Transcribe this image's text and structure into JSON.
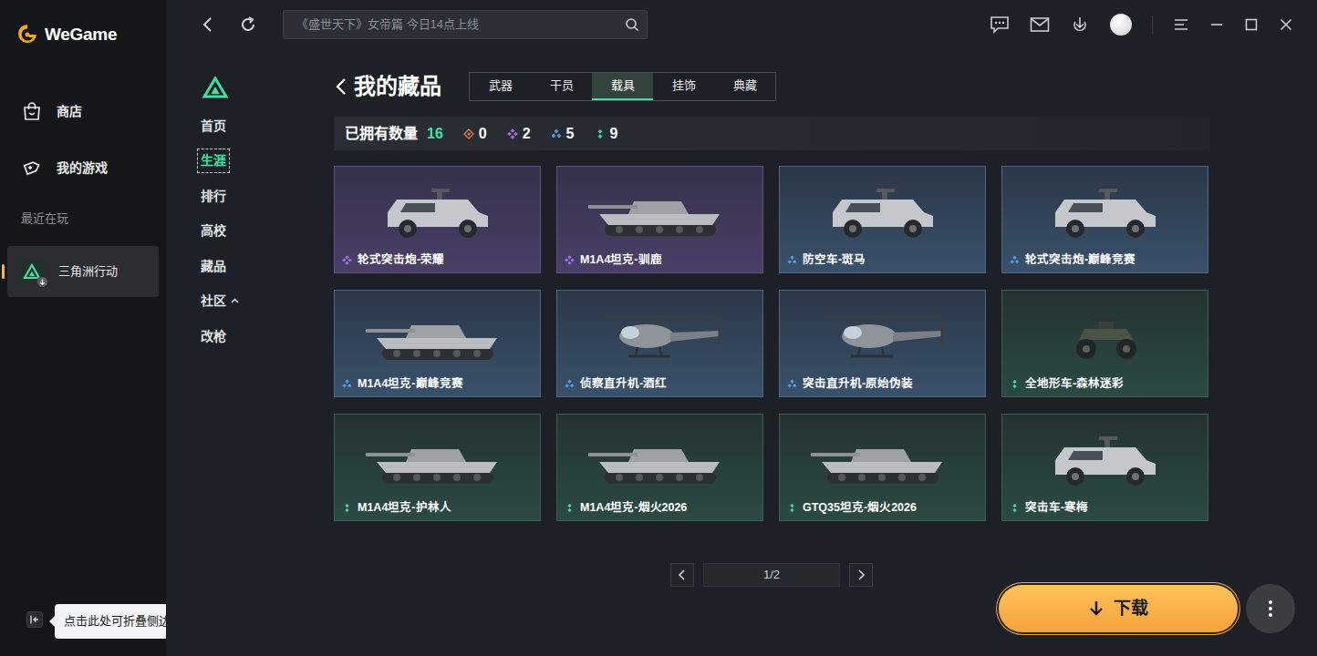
{
  "app": {
    "logo": "WeGame"
  },
  "sidebar": {
    "items": [
      {
        "label": "商店"
      },
      {
        "label": "我的游戏"
      }
    ],
    "recent_label": "最近在玩",
    "recent": [
      {
        "label": "三角洲行动",
        "selected": true
      }
    ],
    "collapse_tooltip": "点击此处可折叠侧边栏"
  },
  "topbar": {
    "search": {
      "placeholder": "《盛世天下》女帝篇 今日14点上线"
    }
  },
  "game_nav": {
    "items": [
      {
        "label": "首页",
        "selected": false
      },
      {
        "label": "生涯",
        "selected": true
      },
      {
        "label": "排行",
        "selected": false
      },
      {
        "label": "高校",
        "selected": false
      },
      {
        "label": "藏品",
        "selected": false
      },
      {
        "label": "社区",
        "selected": false,
        "expanded": true
      },
      {
        "label": "改枪",
        "selected": false
      }
    ]
  },
  "collection": {
    "title": "我的藏品",
    "tabs": [
      {
        "label": "武器",
        "selected": false
      },
      {
        "label": "干员",
        "selected": false
      },
      {
        "label": "载具",
        "selected": true
      },
      {
        "label": "挂饰",
        "selected": false
      },
      {
        "label": "典藏",
        "selected": false
      }
    ],
    "owned_label": "已拥有数量",
    "owned_count": "16",
    "rarity_counts": [
      {
        "rarity": "legendary",
        "count": "0",
        "color": "#e07b39"
      },
      {
        "rarity": "epic",
        "count": "2",
        "color": "#a46cf0"
      },
      {
        "rarity": "rare",
        "count": "5",
        "color": "#4f9fe8"
      },
      {
        "rarity": "common",
        "count": "9",
        "color": "#3fd6a0"
      }
    ],
    "items": [
      {
        "name": "轮式突击炮-荣耀",
        "rarity": "epic",
        "color": "#a46cf0",
        "kind": "car"
      },
      {
        "name": "M1A4坦克-驯鹿",
        "rarity": "epic",
        "color": "#a46cf0",
        "kind": "tank"
      },
      {
        "name": "防空车-斑马",
        "rarity": "rare",
        "color": "#4f9fe8",
        "kind": "car"
      },
      {
        "name": "轮式突击炮-巅峰竞赛",
        "rarity": "rare",
        "color": "#4f9fe8",
        "kind": "car"
      },
      {
        "name": "M1A4坦克-巅峰竞赛",
        "rarity": "rare",
        "color": "#4f9fe8",
        "kind": "tank"
      },
      {
        "name": "侦察直升机-酒红",
        "rarity": "rare",
        "color": "#4f9fe8",
        "kind": "helicopter"
      },
      {
        "name": "突击直升机-原始伪装",
        "rarity": "rare",
        "color": "#4f9fe8",
        "kind": "helicopter"
      },
      {
        "name": "全地形车-森林迷彩",
        "rarity": "common",
        "color": "#3fd6a0",
        "kind": "atv"
      },
      {
        "name": "M1A4坦克-护林人",
        "rarity": "common",
        "color": "#3fd6a0",
        "kind": "tank"
      },
      {
        "name": "M1A4坦克-烟火2026",
        "rarity": "common",
        "color": "#3fd6a0",
        "kind": "tank"
      },
      {
        "name": "GTQ35坦克-烟火2026",
        "rarity": "common",
        "color": "#3fd6a0",
        "kind": "tank"
      },
      {
        "name": "突击车-寒梅",
        "rarity": "common",
        "color": "#3fd6a0",
        "kind": "car"
      }
    ],
    "pagination": {
      "page": "1/2"
    }
  },
  "download_button": {
    "label": "下载"
  }
}
